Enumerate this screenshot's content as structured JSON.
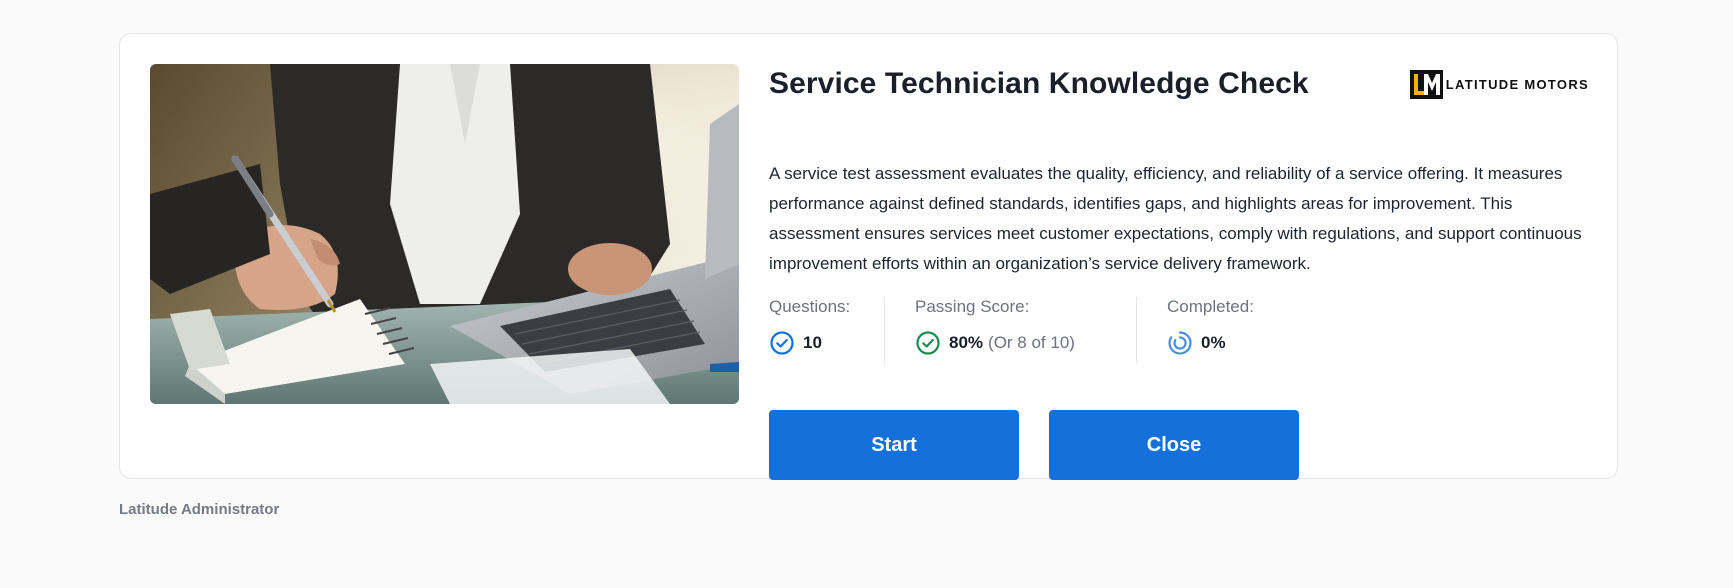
{
  "assessment": {
    "title": "Service Technician Knowledge Check",
    "description": "A service test assessment evaluates the quality, efficiency, and reliability of a service offering. It measures performance against defined standards, identifies gaps, and highlights areas for improvement. This assessment ensures services meet customer expectations, comply with regulations, and support continuous improvement efforts within an organization’s service delivery framework.",
    "image_icon": "photo-person-writing-notebook-laptop"
  },
  "brand": {
    "logo_mark": "LM",
    "logo_text": "LATITUDE MOTORS",
    "accent_color": "#f5b400"
  },
  "stats": {
    "questions": {
      "label": "Questions:",
      "value": "10",
      "icon": "check-circle-icon",
      "color": "#1570dc"
    },
    "passing_score": {
      "label": "Passing Score:",
      "value": "80%",
      "detail": "(Or 8 of 10)",
      "icon": "check-circle-icon",
      "color": "#1a8a4f"
    },
    "completed": {
      "label": "Completed:",
      "value": "0%",
      "icon": "progress-ring-icon",
      "color": "#4a8fe0",
      "progress_fraction": 0
    }
  },
  "actions": {
    "start_label": "Start",
    "close_label": "Close",
    "button_color": "#1570dc"
  },
  "footer": {
    "text": "Latitude Administrator"
  }
}
